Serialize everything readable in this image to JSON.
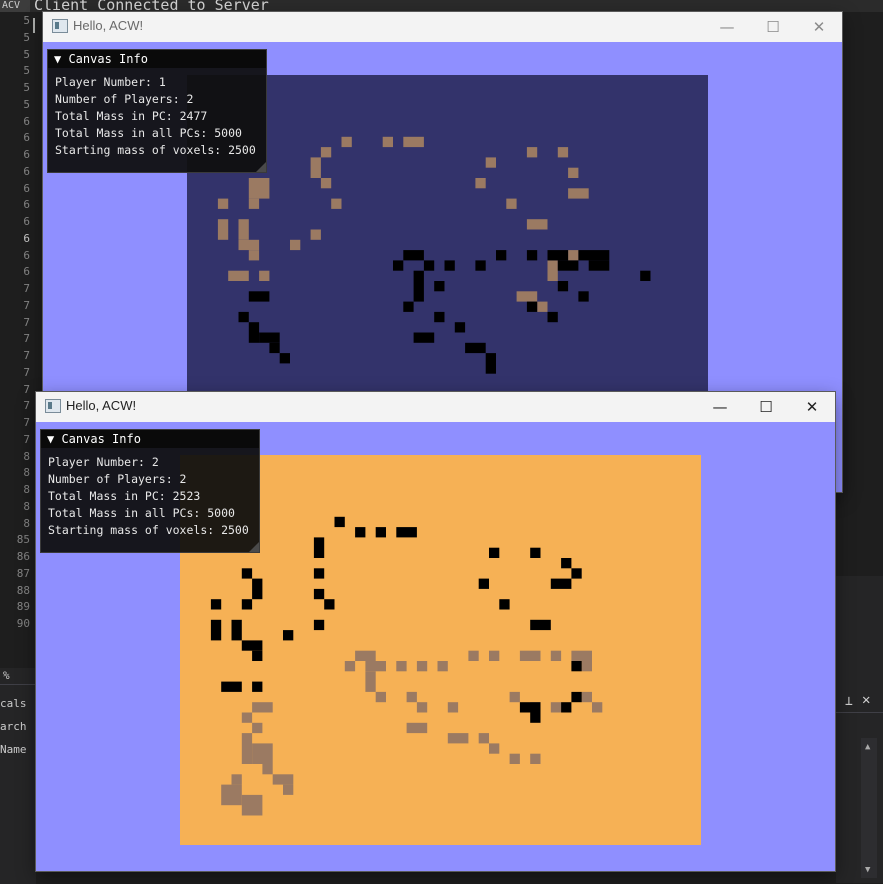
{
  "ide": {
    "menu_stub": "ACV",
    "output_text": "Client Connected to Server",
    "line_numbers": [
      "5",
      "5",
      "5",
      "5",
      "5",
      "5",
      "6",
      "6",
      "6",
      "6",
      "6",
      "6",
      "6",
      "6",
      "6",
      "6",
      "7",
      "7",
      "7",
      "7",
      "7",
      "7",
      "7",
      "7",
      "7",
      "7",
      "8",
      "8",
      "8",
      "8",
      "8",
      "85",
      "86",
      "87",
      "88",
      "89",
      "90"
    ],
    "current_line_index": 13,
    "zoom_label": "%",
    "left_panel": [
      "cals",
      "arch (C",
      "Name"
    ]
  },
  "windows": [
    {
      "title": "Hello, ACW!",
      "canvas_bg": "#33336b",
      "info": {
        "header": "▼ Canvas Info",
        "lines": [
          "Player Number: 1",
          "Number of Players: 2",
          "Total Mass in PC: 2477",
          "Total Mass in all PCs: 5000",
          "Starting mass of voxels: 2500"
        ]
      }
    },
    {
      "title": "Hello, ACW!",
      "canvas_bg": "#f6b155",
      "info": {
        "header": "▼ Canvas Info",
        "lines": [
          "Player Number: 2",
          "Number of Players: 2",
          "Total Mass in PC: 2523",
          "Total Mass in all PCs: 5000",
          "Starting mass of voxels: 2500"
        ]
      }
    }
  ],
  "controls": {
    "minimize": "—",
    "maximize": "☐",
    "close": "✕"
  },
  "colors": {
    "window_bg": "#8f8fff",
    "voxel_brown": "#9b7a62",
    "voxel_black": "#000000"
  }
}
